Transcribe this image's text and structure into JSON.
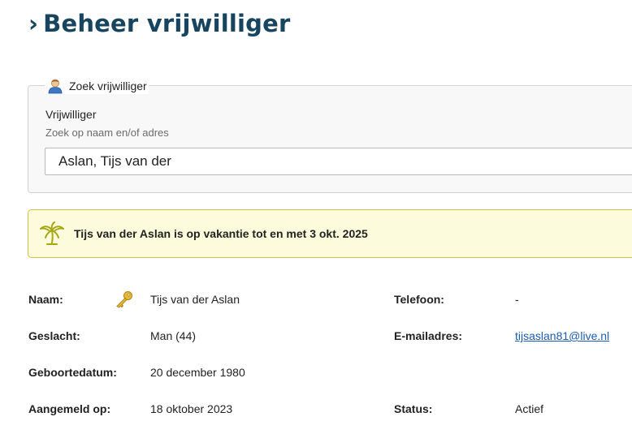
{
  "page": {
    "title_chevron": "›",
    "title": "Beheer vrijwilliger"
  },
  "search": {
    "legend": "Zoek vrijwilliger",
    "legend_icon": "user-icon",
    "label": "Vrijwilliger",
    "help": "Zoek op naam en/of adres",
    "value": "Aslan, Tijs van der"
  },
  "alert": {
    "icon": "palm-tree-icon",
    "text": "Tijs van der Aslan is op vakantie tot en met 3 okt. 2025",
    "background": "#fcfcdc",
    "border": "#c7c24a"
  },
  "details": {
    "name_label": "Naam:",
    "name_icon": "key-icon",
    "name_value": "Tijs van der Aslan",
    "gender_label": "Geslacht:",
    "gender_value": "Man (44)",
    "birthdate_label": "Geboortedatum:",
    "birthdate_value": "20 december 1980",
    "registered_label": "Aangemeld op:",
    "registered_value": "18 oktober 2023",
    "phone_label": "Telefoon:",
    "phone_value": "-",
    "email_label": "E-mailadres:",
    "email_value": "tijsaslan81@live.nl",
    "status_label": "Status:",
    "status_value": "Actief"
  },
  "colors": {
    "title": "#17445e",
    "link": "#1a5bb3"
  }
}
